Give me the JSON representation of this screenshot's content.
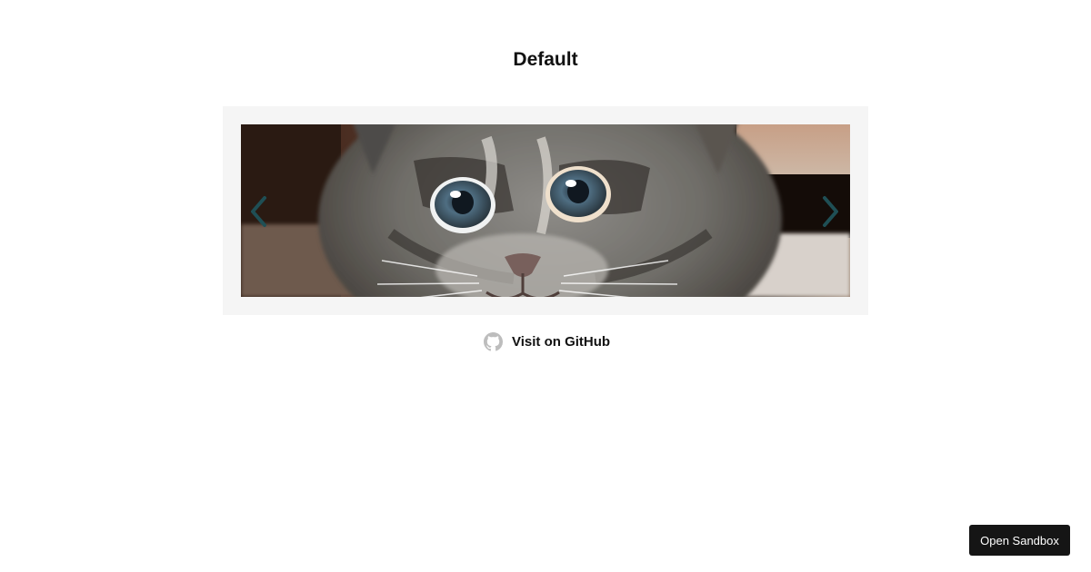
{
  "page": {
    "title": "Default"
  },
  "carousel": {
    "prev_icon": "chevron-left-icon",
    "next_icon": "chevron-right-icon",
    "arrow_color": "#1f4f55",
    "frame_color": "#f5f5f5"
  },
  "github": {
    "icon": "github-icon",
    "label": "Visit on GitHub"
  },
  "sandbox": {
    "label": "Open Sandbox",
    "color": "#151515"
  }
}
